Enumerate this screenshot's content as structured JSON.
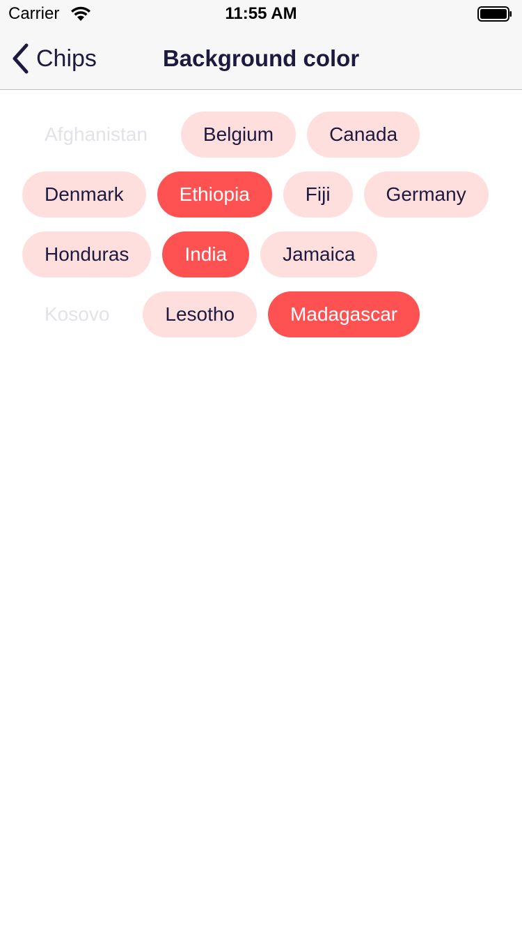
{
  "status_bar": {
    "carrier": "Carrier",
    "time": "11:55 AM",
    "wifi_icon": "wifi-icon",
    "battery_icon": "battery-icon"
  },
  "nav": {
    "back_label": "Chips",
    "back_icon": "chevron-left-icon",
    "title": "Background color"
  },
  "colors": {
    "chip_background": "#ffdede",
    "chip_selected_background": "#fe5252",
    "chip_text": "#1d1a3f",
    "chip_selected_text": "#ffffff",
    "chip_disabled_text": "#e3e2e8"
  },
  "chips": {
    "rows": [
      [
        {
          "label": "Afghanistan",
          "state": "disabled"
        },
        {
          "label": "Belgium",
          "state": "normal"
        },
        {
          "label": "Canada",
          "state": "normal"
        }
      ],
      [
        {
          "label": "Denmark",
          "state": "normal"
        },
        {
          "label": "Ethiopia",
          "state": "selected"
        },
        {
          "label": "Fiji",
          "state": "normal"
        },
        {
          "label": "Germany",
          "state": "normal"
        }
      ],
      [
        {
          "label": "Honduras",
          "state": "normal"
        },
        {
          "label": "India",
          "state": "selected"
        },
        {
          "label": "Jamaica",
          "state": "normal"
        }
      ],
      [
        {
          "label": "Kosovo",
          "state": "disabled"
        },
        {
          "label": "Lesotho",
          "state": "normal"
        },
        {
          "label": "Madagascar",
          "state": "selected"
        }
      ]
    ]
  }
}
